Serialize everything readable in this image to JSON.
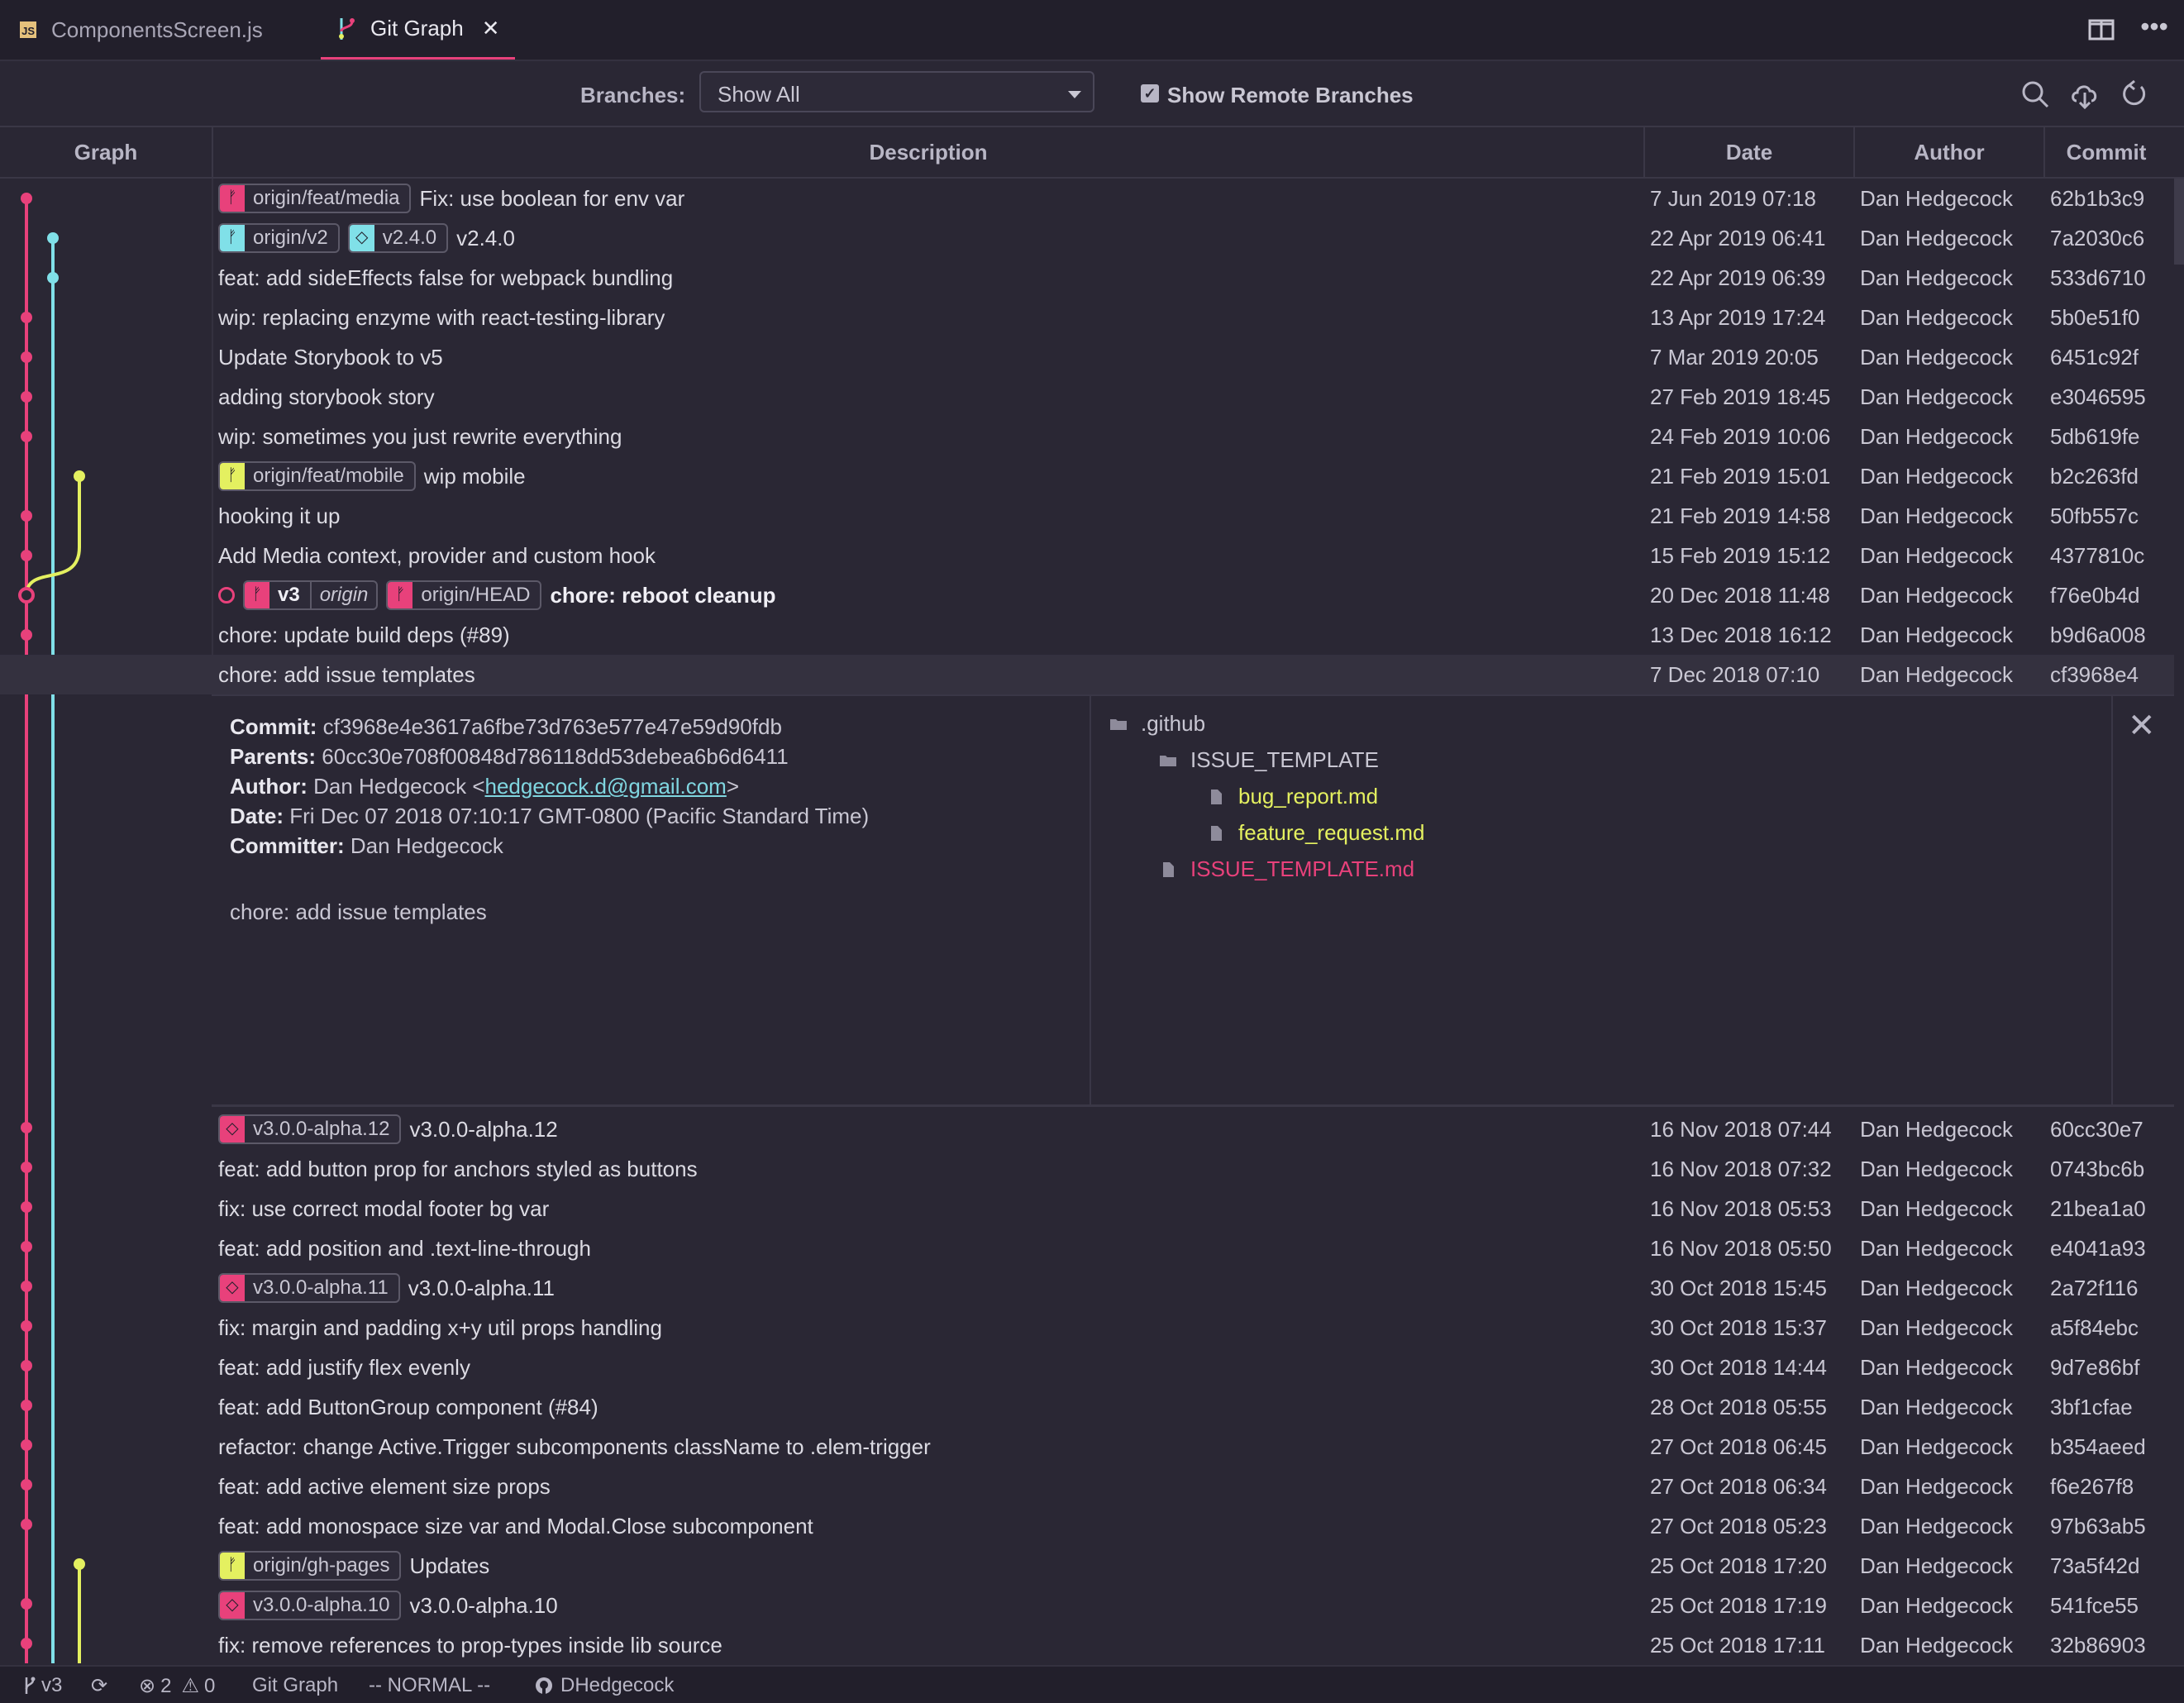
{
  "tabs": [
    {
      "label": "ComponentsScreen.js",
      "icon": "js-file-icon",
      "active": false
    },
    {
      "label": "Git Graph",
      "icon": "git-graph-icon",
      "active": true
    }
  ],
  "controls": {
    "branches_label": "Branches:",
    "branches_value": "Show All",
    "remote_label": "Show Remote Branches",
    "remote_checked": true
  },
  "columns": {
    "graph": "Graph",
    "description": "Description",
    "date": "Date",
    "author": "Author",
    "commit": "Commit"
  },
  "colors": {
    "pink": "#e8417b",
    "cyan": "#80e0e8",
    "yellow": "#e4f060",
    "background": "#2a2734"
  },
  "commits_top": [
    {
      "refs": [
        {
          "type": "branch",
          "name": "origin/feat/media",
          "color": "#e8417b"
        }
      ],
      "message": "Fix: use boolean for env var",
      "date": "7 Jun 2019 07:18",
      "author": "Dan Hedgecock",
      "hash": "62b1b3c9"
    },
    {
      "refs": [
        {
          "type": "branch",
          "name": "origin/v2",
          "color": "#80e0e8"
        },
        {
          "type": "tag",
          "name": "v2.4.0",
          "color": "#80e0e8"
        }
      ],
      "message": "v2.4.0",
      "date": "22 Apr 2019 06:41",
      "author": "Dan Hedgecock",
      "hash": "7a2030c6"
    },
    {
      "refs": [],
      "message": "feat: add sideEffects false for webpack bundling",
      "date": "22 Apr 2019 06:39",
      "author": "Dan Hedgecock",
      "hash": "533d6710"
    },
    {
      "refs": [],
      "message": "wip: replacing enzyme with react-testing-library",
      "date": "13 Apr 2019 17:24",
      "author": "Dan Hedgecock",
      "hash": "5b0e51f0"
    },
    {
      "refs": [],
      "message": "Update Storybook to v5",
      "date": "7 Mar 2019 20:05",
      "author": "Dan Hedgecock",
      "hash": "6451c92f"
    },
    {
      "refs": [],
      "message": "adding storybook story",
      "date": "27 Feb 2019 18:45",
      "author": "Dan Hedgecock",
      "hash": "e3046595"
    },
    {
      "refs": [],
      "message": "wip: sometimes you just rewrite everything",
      "date": "24 Feb 2019 10:06",
      "author": "Dan Hedgecock",
      "hash": "5db619fe"
    },
    {
      "refs": [
        {
          "type": "branch",
          "name": "origin/feat/mobile",
          "color": "#e4f060"
        }
      ],
      "message": "wip mobile",
      "date": "21 Feb 2019 15:01",
      "author": "Dan Hedgecock",
      "hash": "b2c263fd"
    },
    {
      "refs": [],
      "message": "hooking it up",
      "date": "21 Feb 2019 14:58",
      "author": "Dan Hedgecock",
      "hash": "50fb557c"
    },
    {
      "refs": [],
      "message": "Add Media context, provider and custom hook",
      "date": "15 Feb 2019 15:12",
      "author": "Dan Hedgecock",
      "hash": "4377810c"
    },
    {
      "refs": [
        {
          "type": "head",
          "name": "v3",
          "origin": "origin",
          "color": "#e8417b"
        },
        {
          "type": "branch",
          "name": "origin/HEAD",
          "color": "#e8417b"
        }
      ],
      "message": "chore: reboot cleanup",
      "bold": true,
      "date": "20 Dec 2018 11:48",
      "author": "Dan Hedgecock",
      "hash": "f76e0b4d"
    },
    {
      "refs": [],
      "message": "chore: update build deps (#89)",
      "date": "13 Dec 2018 16:12",
      "author": "Dan Hedgecock",
      "hash": "b9d6a008"
    },
    {
      "refs": [],
      "message": "chore: add issue templates",
      "date": "7 Dec 2018 07:10",
      "author": "Dan Hedgecock",
      "hash": "cf3968e4",
      "selected": true
    }
  ],
  "details": {
    "commit_label": "Commit:",
    "commit": "cf3968e4e3617a6fbe73d763e577e47e59d90fdb",
    "parents_label": "Parents:",
    "parents": "60cc30e708f00848d786118dd53debea6b6d6411",
    "author_label": "Author:",
    "author_name": "Dan Hedgecock <",
    "author_email": "hedgecock.d@gmail.com",
    "author_close": ">",
    "date_label": "Date:",
    "date": "Fri Dec 07 2018 07:10:17 GMT-0800 (Pacific Standard Time)",
    "committer_label": "Committer:",
    "committer": "Dan Hedgecock",
    "message": "chore: add issue templates",
    "files": [
      {
        "name": ".github",
        "type": "folder",
        "color": "#c9c7d3"
      },
      {
        "name": "ISSUE_TEMPLATE",
        "type": "folder",
        "color": "#c9c7d3"
      },
      {
        "name": "bug_report.md",
        "type": "file",
        "color": "#e4f060"
      },
      {
        "name": "feature_request.md",
        "type": "file",
        "color": "#e4f060"
      },
      {
        "name": "ISSUE_TEMPLATE.md",
        "type": "file",
        "color": "#e8417b"
      }
    ]
  },
  "commits_bottom": [
    {
      "refs": [
        {
          "type": "tag",
          "name": "v3.0.0-alpha.12",
          "color": "#e8417b"
        }
      ],
      "message": "v3.0.0-alpha.12",
      "date": "16 Nov 2018 07:44",
      "author": "Dan Hedgecock",
      "hash": "60cc30e7"
    },
    {
      "refs": [],
      "message": "feat: add button prop for anchors styled as buttons",
      "date": "16 Nov 2018 07:32",
      "author": "Dan Hedgecock",
      "hash": "0743bc6b"
    },
    {
      "refs": [],
      "message": "fix: use correct modal footer bg var",
      "date": "16 Nov 2018 05:53",
      "author": "Dan Hedgecock",
      "hash": "21bea1a0"
    },
    {
      "refs": [],
      "message": "feat: add position and .text-line-through",
      "date": "16 Nov 2018 05:50",
      "author": "Dan Hedgecock",
      "hash": "e4041a93"
    },
    {
      "refs": [
        {
          "type": "tag",
          "name": "v3.0.0-alpha.11",
          "color": "#e8417b"
        }
      ],
      "message": "v3.0.0-alpha.11",
      "date": "30 Oct 2018 15:45",
      "author": "Dan Hedgecock",
      "hash": "2a72f116"
    },
    {
      "refs": [],
      "message": "fix: margin and padding x+y util props handling",
      "date": "30 Oct 2018 15:37",
      "author": "Dan Hedgecock",
      "hash": "a5f84ebc"
    },
    {
      "refs": [],
      "message": "feat: add justify flex evenly",
      "date": "30 Oct 2018 14:44",
      "author": "Dan Hedgecock",
      "hash": "9d7e86bf"
    },
    {
      "refs": [],
      "message": "feat: add ButtonGroup component (#84)",
      "date": "28 Oct 2018 05:55",
      "author": "Dan Hedgecock",
      "hash": "3bf1cfae"
    },
    {
      "refs": [],
      "message": "refactor: change Active.Trigger subcomponents className to .elem-trigger",
      "date": "27 Oct 2018 06:45",
      "author": "Dan Hedgecock",
      "hash": "b354aeed"
    },
    {
      "refs": [],
      "message": "feat: add active element size props",
      "date": "27 Oct 2018 06:34",
      "author": "Dan Hedgecock",
      "hash": "f6e267f8"
    },
    {
      "refs": [],
      "message": "feat: add monospace size var and Modal.Close subcomponent",
      "date": "27 Oct 2018 05:23",
      "author": "Dan Hedgecock",
      "hash": "97b63ab5"
    },
    {
      "refs": [
        {
          "type": "branch",
          "name": "origin/gh-pages",
          "color": "#e4f060"
        }
      ],
      "message": "Updates",
      "date": "25 Oct 2018 17:20",
      "author": "Dan Hedgecock",
      "hash": "73a5f42d"
    },
    {
      "refs": [
        {
          "type": "tag",
          "name": "v3.0.0-alpha.10",
          "color": "#e8417b"
        }
      ],
      "message": "v3.0.0-alpha.10",
      "date": "25 Oct 2018 17:19",
      "author": "Dan Hedgecock",
      "hash": "541fce55"
    },
    {
      "refs": [],
      "message": "fix: remove references to prop-types inside lib source",
      "date": "25 Oct 2018 17:11",
      "author": "Dan Hedgecock",
      "hash": "32b86903"
    }
  ],
  "status": {
    "branch": "v3",
    "errors": "2",
    "warnings": "0",
    "view": "Git Graph",
    "mode": "-- NORMAL --",
    "user": "DHedgecock"
  }
}
